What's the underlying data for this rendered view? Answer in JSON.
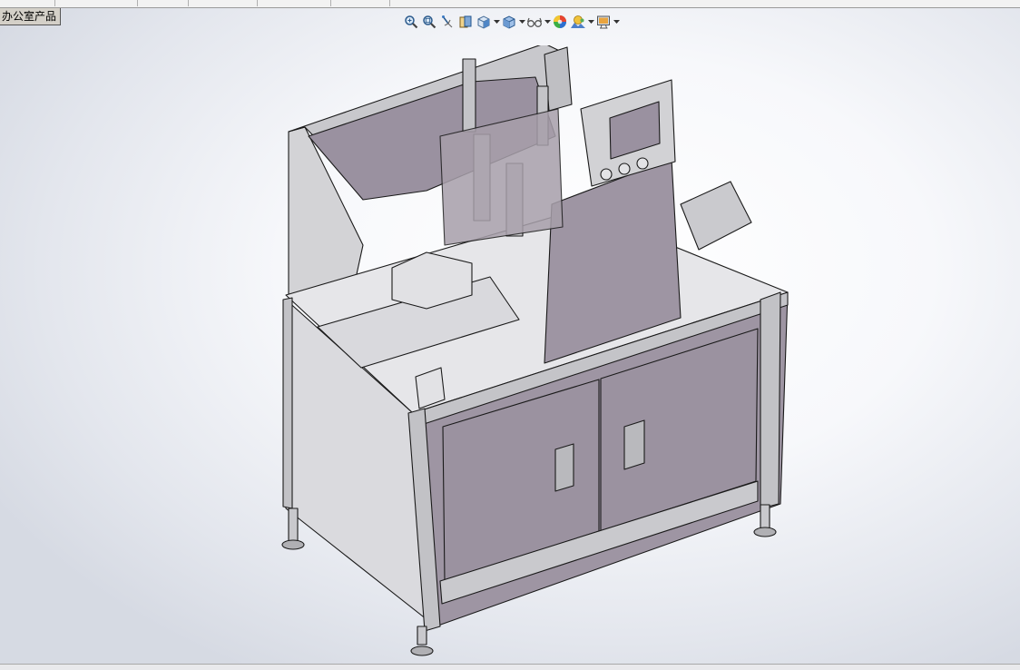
{
  "document_tab": {
    "label": "办公室产品"
  },
  "heads_up_toolbar": {
    "buttons": [
      {
        "name": "zoom-to-fit",
        "icon": "zoom-to-fit-icon",
        "has_dropdown": false
      },
      {
        "name": "zoom-to-area",
        "icon": "zoom-to-area-icon",
        "has_dropdown": false
      },
      {
        "name": "previous-view",
        "icon": "previous-view-icon",
        "has_dropdown": false
      },
      {
        "name": "section-view",
        "icon": "section-view-icon",
        "has_dropdown": false
      },
      {
        "name": "view-orientation",
        "icon": "view-orientation-icon",
        "has_dropdown": true
      },
      {
        "name": "display-style",
        "icon": "display-style-icon",
        "has_dropdown": true
      },
      {
        "name": "hide-show-items",
        "icon": "hide-show-items-icon",
        "has_dropdown": true
      },
      {
        "name": "edit-appearance",
        "icon": "edit-appearance-icon",
        "has_dropdown": false
      },
      {
        "name": "apply-scene",
        "icon": "apply-scene-icon",
        "has_dropdown": true
      },
      {
        "name": "view-settings",
        "icon": "view-settings-icon",
        "has_dropdown": true
      }
    ]
  },
  "viewport": {
    "background_top": "#ffffff",
    "background_edge": "#d6dae3",
    "model_face": "#9e95a3",
    "model_frame": "#c9c9cc",
    "model_edge": "#1a1a1a"
  }
}
